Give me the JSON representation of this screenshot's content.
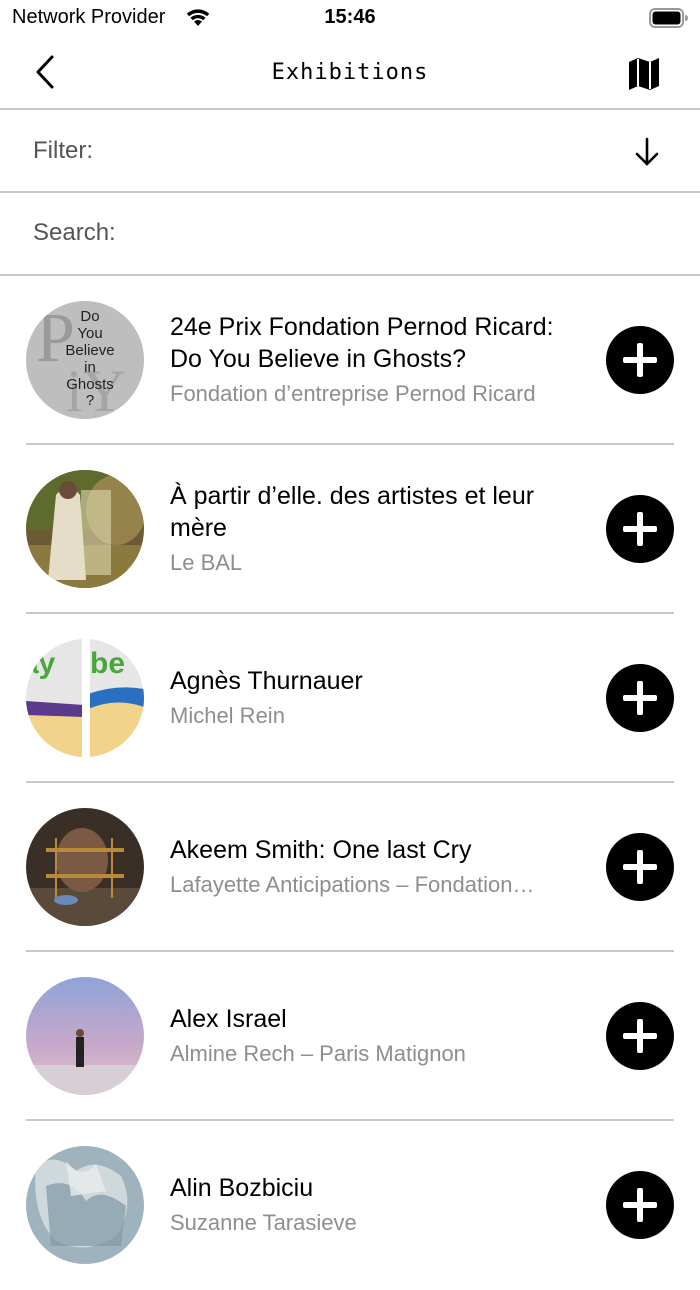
{
  "status_bar": {
    "carrier": "Network Provider",
    "time": "15:46"
  },
  "nav": {
    "title": "Exhibitions"
  },
  "filter": {
    "label": "Filter:"
  },
  "search": {
    "placeholder": "Search:"
  },
  "exhibitions": [
    {
      "title": "24e Prix Fondation Pernod Ricard: Do You Believe in Ghosts?",
      "venue": "Fondation d’entreprise Pernod Ricard",
      "thumb_text": [
        "Do",
        "You",
        "Believe",
        "in",
        "Ghosts",
        "?"
      ]
    },
    {
      "title": "À partir d’elle. des artistes et leur mère",
      "venue": "Le BAL"
    },
    {
      "title": "Agnès Thurnauer",
      "venue": "Michel Rein",
      "thumb_text": [
        "ay",
        "be"
      ]
    },
    {
      "title": "Akeem Smith: One last Cry",
      "venue": "Lafayette Anticipations – Fondation…"
    },
    {
      "title": "Alex Israel",
      "venue": "Almine Rech – Paris Matignon"
    },
    {
      "title": "Alin Bozbiciu",
      "venue": "Suzanne Tarasieve"
    }
  ]
}
